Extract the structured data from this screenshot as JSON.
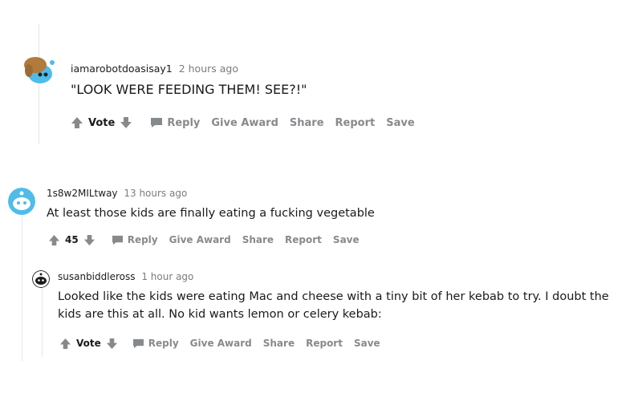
{
  "comments": [
    {
      "username": "iamarobotdoasisay1",
      "time": "2 hours ago",
      "body": "\"LOOK WERE FEEDING THEM! SEE?!\"",
      "score": "Vote"
    },
    {
      "username": "1s8w2MILtway",
      "time": "13 hours ago",
      "body": "At least those kids are finally eating a fucking vegetable",
      "score": "45"
    },
    {
      "username": "susanbiddleross",
      "time": "1 hour ago",
      "body": "Looked like the kids were eating Mac and cheese with a tiny bit of her kebab to try. I doubt the kids are this at all. No kid wants lemon or celery kebab:",
      "score": "Vote"
    }
  ],
  "actions": {
    "reply": "Reply",
    "give_award": "Give Award",
    "share": "Share",
    "report": "Report",
    "save": "Save"
  },
  "icons": {
    "upvote": "upvote-arrow-icon",
    "downvote": "downvote-arrow-icon",
    "reply": "comment-bubble-icon"
  },
  "colors": {
    "action_gray": "#878a8c",
    "thread_line": "#e6e6e6",
    "avatar_blue": "#4fbcea"
  }
}
